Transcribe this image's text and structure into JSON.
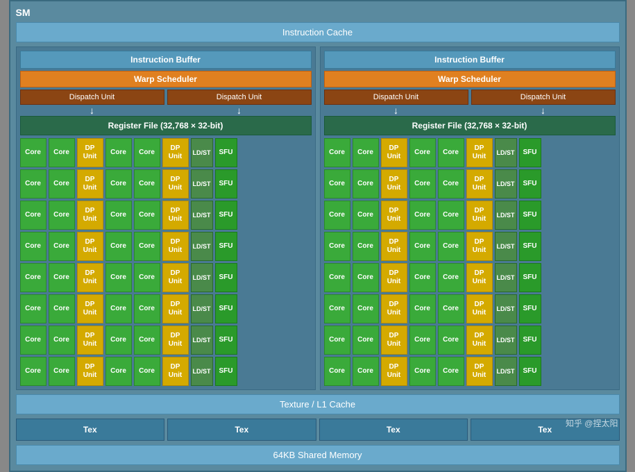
{
  "title": "SM",
  "instruction_cache": "Instruction Cache",
  "left": {
    "inst_buffer": "Instruction Buffer",
    "warp_scheduler": "Warp Scheduler",
    "dispatch1": "Dispatch Unit",
    "dispatch2": "Dispatch Unit",
    "register_file": "Register File (32,768 × 32-bit)"
  },
  "right": {
    "inst_buffer": "Instruction Buffer",
    "warp_scheduler": "Warp Scheduler",
    "dispatch1": "Dispatch Unit",
    "dispatch2": "Dispatch Unit",
    "register_file": "Register File (32,768 × 32-bit)"
  },
  "texture_cache": "Texture / L1 Cache",
  "tex_labels": [
    "Tex",
    "Tex",
    "Tex",
    "Tex"
  ],
  "shared_memory": "64KB Shared Memory",
  "watermark": "知乎 @捏太阳",
  "rows": 8,
  "colors": {
    "core_green": "#3aaa3a",
    "core_yellow": "#d4aa00",
    "ldst_green": "#4a8a4a",
    "sfu_green": "#2aaa2a",
    "bg": "#5a8a9f"
  }
}
